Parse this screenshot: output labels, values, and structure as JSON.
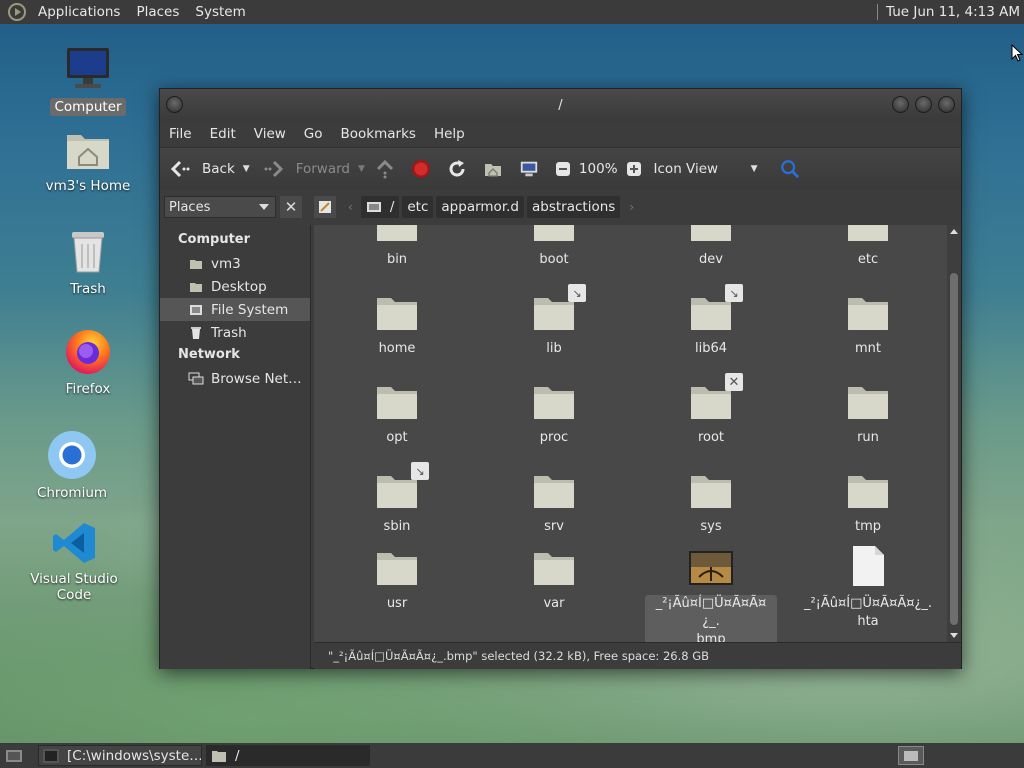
{
  "top_panel": {
    "menus": [
      "Applications",
      "Places",
      "System"
    ],
    "clock": "Tue Jun 11,  4:13 AM"
  },
  "desktop_icons": [
    {
      "label": "Computer",
      "icon": "computer-icon"
    },
    {
      "label": "vm3's Home",
      "icon": "home-folder-icon"
    },
    {
      "label": "Trash",
      "icon": "trash-icon"
    },
    {
      "label": "Firefox",
      "icon": "firefox-icon"
    },
    {
      "label": "Chromium",
      "icon": "chromium-icon"
    },
    {
      "label": "Visual Studio Code",
      "icon": "vscode-icon"
    }
  ],
  "window": {
    "title": "/",
    "menu": [
      "File",
      "Edit",
      "View",
      "Go",
      "Bookmarks",
      "Help"
    ],
    "toolbar": {
      "back": "Back",
      "forward": "Forward",
      "zoom": "100%",
      "view_mode": "Icon View"
    },
    "places_combo": "Places",
    "path": {
      "root": "/",
      "crumbs": [
        "etc",
        "apparmor.d",
        "abstractions"
      ]
    },
    "sidebar": {
      "computer_head": "Computer",
      "computer_items": [
        {
          "label": "vm3",
          "icon": "home-icon"
        },
        {
          "label": "Desktop",
          "icon": "desktop-icon"
        },
        {
          "label": "File System",
          "icon": "drive-icon",
          "selected": true
        },
        {
          "label": "Trash",
          "icon": "trash-icon"
        }
      ],
      "network_head": "Network",
      "network_items": [
        {
          "label": "Browse Net…",
          "icon": "network-icon"
        }
      ]
    },
    "files": [
      {
        "name": "bin"
      },
      {
        "name": "boot"
      },
      {
        "name": "dev"
      },
      {
        "name": "etc"
      },
      {
        "name": "home"
      },
      {
        "name": "lib",
        "badge": "link"
      },
      {
        "name": "lib64",
        "badge": "link"
      },
      {
        "name": "mnt"
      },
      {
        "name": "opt"
      },
      {
        "name": "proc"
      },
      {
        "name": "root",
        "badge": "locked"
      },
      {
        "name": "run"
      },
      {
        "name": "sbin",
        "badge": "link"
      },
      {
        "name": "srv"
      },
      {
        "name": "sys"
      },
      {
        "name": "tmp"
      },
      {
        "name": "usr"
      },
      {
        "name": "var"
      },
      {
        "name": "_²¡Ãû¤Í□Ü¤Ã¤Ã¤¿_.\nbmp",
        "type": "image",
        "selected": true
      },
      {
        "name": "_²¡Ãû¤Í□Ü¤Ã¤Ã¤¿_.\nhta",
        "type": "document"
      }
    ],
    "status": "\"_²¡Ãû¤Í□Ü¤Ã¤Ã¤¿_.bmp\" selected (32.2 kB), Free space: 26.8 GB"
  },
  "bottom_panel": {
    "tasks": [
      {
        "label": "[C:\\windows\\syste…",
        "icon": "terminal-icon"
      },
      {
        "label": "/",
        "icon": "folder-icon",
        "active": true
      }
    ]
  }
}
